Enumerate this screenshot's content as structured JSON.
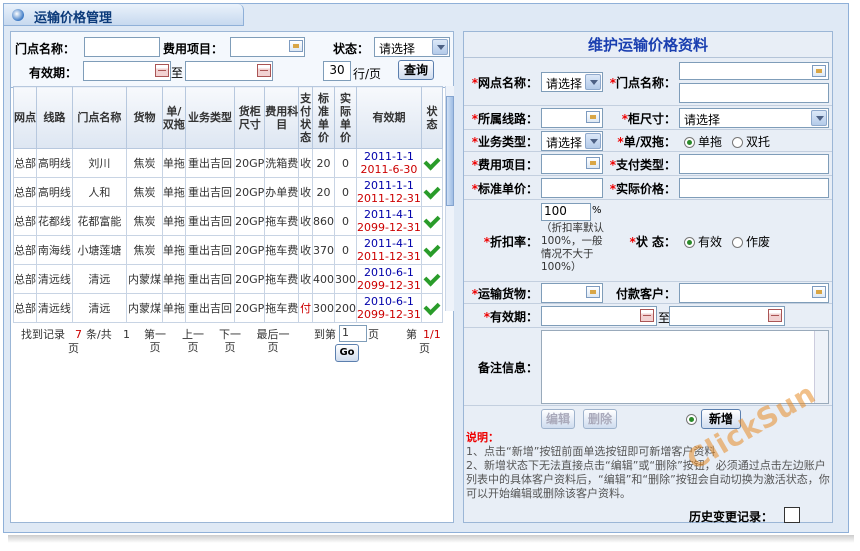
{
  "window": {
    "title": "运输价格管理"
  },
  "filter": {
    "store_label": "门点名称：",
    "fee_label": "费用项目：",
    "status_label": "状态：",
    "status_value": "请选择",
    "valid_label": "有效期：",
    "to_label": "至",
    "page_size": "30",
    "page_size_unit": "行/页",
    "query_button": "查询"
  },
  "table": {
    "headers": [
      "网点",
      "线路",
      "门点名称",
      "货物",
      "单/双拖",
      "业务类型",
      "货柜尺寸",
      "费用科目",
      "支付状态",
      "标准单价",
      "实际单价",
      "有效期",
      "状态"
    ],
    "rows": [
      {
        "site": "总部",
        "line": "高明线",
        "store": "刘川",
        "cargo": "焦炭",
        "tow": "单拖",
        "biz": "重出吉回",
        "size": "20GP",
        "fee": "洗箱费",
        "pay": "收",
        "std": "20",
        "act": "0",
        "from": "2011-1-1",
        "to": "2011-6-30"
      },
      {
        "site": "总部",
        "line": "高明线",
        "store": "人和",
        "cargo": "焦炭",
        "tow": "单拖",
        "biz": "重出吉回",
        "size": "20GP",
        "fee": "办单费",
        "pay": "收",
        "std": "20",
        "act": "0",
        "from": "2011-1-1",
        "to": "2011-12-31"
      },
      {
        "site": "总部",
        "line": "花都线",
        "store": "花都富能",
        "cargo": "焦炭",
        "tow": "单拖",
        "biz": "重出吉回",
        "size": "20GP",
        "fee": "拖车费",
        "pay": "收",
        "std": "860",
        "act": "0",
        "from": "2011-4-1",
        "to": "2099-12-31"
      },
      {
        "site": "总部",
        "line": "南海线",
        "store": "小塘莲塘",
        "cargo": "焦炭",
        "tow": "单拖",
        "biz": "重出吉回",
        "size": "20GP",
        "fee": "拖车费",
        "pay": "收",
        "std": "370",
        "act": "0",
        "from": "2011-4-1",
        "to": "2011-12-31"
      },
      {
        "site": "总部",
        "line": "清远线",
        "store": "清远",
        "cargo": "内蒙煤",
        "tow": "单拖",
        "biz": "重出吉回",
        "size": "20GP",
        "fee": "拖车费",
        "pay": "收",
        "std": "400",
        "act": "300",
        "from": "2010-6-1",
        "to": "2099-12-31"
      },
      {
        "site": "总部",
        "line": "清远线",
        "store": "清远",
        "cargo": "内蒙煤",
        "tow": "单拖",
        "biz": "重出吉回",
        "size": "20GP",
        "fee": "拖车费",
        "pay": "付",
        "std": "300",
        "act": "200",
        "from": "2010-6-1",
        "to": "2099-12-31"
      }
    ]
  },
  "pager": {
    "found": "找到记录",
    "count": "7",
    "unit_of": "条/共",
    "pages": "1",
    "page_word": "页",
    "first": "第一页",
    "prev": "上一页",
    "next": "下一页",
    "last": "最后一页",
    "goto_prefix": "到第",
    "goto_value": "1",
    "goto_suffix": "页",
    "go_button": "Go",
    "current_prefix": "第",
    "current": "1/1",
    "current_suffix": "页"
  },
  "form": {
    "title": "维护运输价格资料",
    "site_label": "网点名称：",
    "site_value": "请选择",
    "store_label": "门点名称：",
    "line_label": "所属线路：",
    "size_label": "柜尺寸：",
    "size_value": "请选择",
    "biz_label": "业务类型：",
    "biz_value": "请选择",
    "tow_label": "单/双拖：",
    "tow_single": "单拖",
    "tow_double": "双托",
    "fee_label": "费用项目：",
    "paytype_label": "支付类型：",
    "std_label": "标准单价：",
    "act_label": "实际价格：",
    "discount_label": "折扣率：",
    "discount_value": "100",
    "discount_unit": "%",
    "discount_hint": "（折扣率默认100%，一般情况不大于100%）",
    "status_label": "状 态：",
    "status_on": "有效",
    "status_off": "作废",
    "cargo_label": "运输货物：",
    "customer_label": "付款客户：",
    "valid_label": "有效期：",
    "to_label": "至",
    "remark_label": "备注信息：",
    "edit_button": "编辑",
    "delete_button": "删除",
    "add_button": "新增",
    "note_title": "说明：",
    "note1": "1、点击“新增”按钮前面单选按钮即可新增客户资料",
    "note2": "2、新增状态下无法直接点击“编辑”或“删除”按钮，必须通过点击左边账户列表中的具体客户资料后，“编辑”和“删除”按钮会自动切换为激活状态，你可以开始编辑或删除该客户资料。",
    "history_label": "历史变更记录："
  },
  "watermark": "ClickSun"
}
